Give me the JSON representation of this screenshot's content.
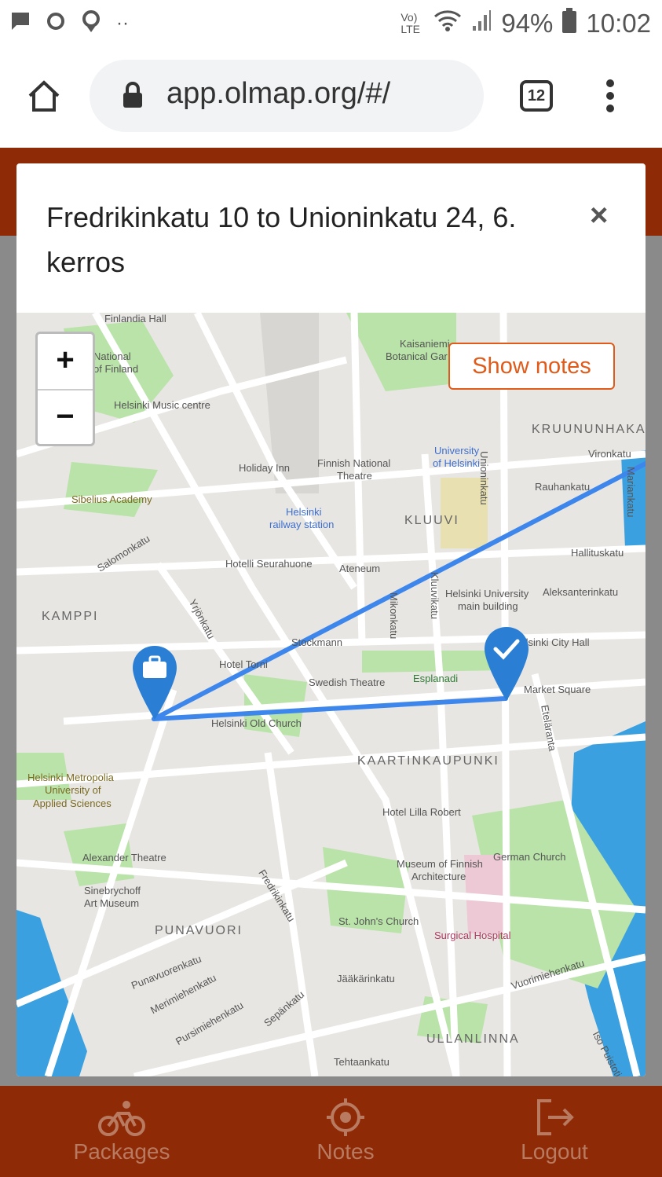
{
  "statusbar": {
    "network": "Vo) LTE",
    "battery": "94%",
    "time": "10:02"
  },
  "browser": {
    "url": "app.olmap.org/#/",
    "tab_count": "12"
  },
  "modal": {
    "title": "Fredrikinkatu 10 to Unioninkatu 24, 6. kerros",
    "close": "×"
  },
  "map": {
    "show_notes": "Show notes",
    "zoom_in": "+",
    "zoom_out": "−",
    "labels": {
      "finlandia_hall": "Finlandia Hall",
      "national_museum": "National",
      "national_museum2": "of Finland",
      "music_centre": "Helsinki Music centre",
      "kaisaniemi": "Kaisaniemi",
      "botanical": "Botanical Gar",
      "sibelius": "Sibelius Academy",
      "holiday_inn": "Holiday Inn",
      "finnish_national_theatre": "Finnish National",
      "finnish_national_theatre2": "Theatre",
      "university": "University",
      "university2": "of Helsinki",
      "unioninkatu": "Unioninkatu",
      "kruununhaka": "KRUUNUNHAKA",
      "vironkatu": "Vironkatu",
      "rauhankatu": "Rauhankatu",
      "mariankatu": "Mariankatu",
      "railway": "Helsinki",
      "railway2": "railway station",
      "kluuvi": "KLUUVI",
      "hallituskatu": "Hallituskatu",
      "salomonkatu": "Salomonkatu",
      "seurahuone": "Hotelli Seurahuone",
      "ateneum": "Ateneum",
      "main_building": "Helsinki University",
      "main_building2": "main building",
      "aleksanterinkatu": "Aleksanterinkatu",
      "kamppi": "KAMPPI",
      "yrjonkatu": "Yrjönkatu",
      "mikonkatu": "Mikonkatu",
      "kluuvikatu": "Kluuvikatu",
      "stockmann": "Stockmann",
      "city_hall": "Helsinki City Hall",
      "hotel_torni": "Hotel Torni",
      "swedish_theatre": "Swedish Theatre",
      "esplanadi": "Esplanadi",
      "market_square": "Market Square",
      "old_church": "Helsinki Old Church",
      "etelaranta": "Eteläranta",
      "kaartinkaupunki": "KAARTINKAUPUNKI",
      "metropolia": "Helsinki Metropolia",
      "metropolia2": "University of",
      "metropolia3": "Applied Sciences",
      "lilla_robert": "Hotel Lilla Robert",
      "alexander_theatre": "Alexander Theatre",
      "museum_architecture": "Museum of Finnish",
      "museum_architecture2": "Architecture",
      "german_church": "German Church",
      "sinebrychoff": "Sinebrychoff",
      "sinebrychoff2": "Art Museum",
      "fredrikinkatu": "Fredrikinkatu",
      "punavuori": "PUNAVUORI",
      "st_johns": "St. John's Church",
      "surgical": "Surgical Hospital",
      "punavuorenkatu": "Punavuorenkatu",
      "merimiehenkatu": "Merimiehenkatu",
      "jaakarinkatu": "Jääkärinkatu",
      "vuorimiehenkatu": "Vuorimiehenkatu",
      "pursimiehenkatu": "Pursimiehenkatu",
      "sepankatu": "Sepänkatu",
      "ullanlinna": "ULLANLINNA",
      "tehtaankatu": "Tehtaankatu",
      "iso_puistotie": "Iso Puistotie"
    }
  },
  "bottom_nav": {
    "packages": "Packages",
    "notes": "Notes",
    "logout": "Logout"
  },
  "colors": {
    "brand": "#8e2a06",
    "route": "#3d86ec",
    "marker": "#2a7fd4",
    "accent": "#e05a1a",
    "water": "#3aa0e0",
    "park": "#b9e3a8"
  }
}
